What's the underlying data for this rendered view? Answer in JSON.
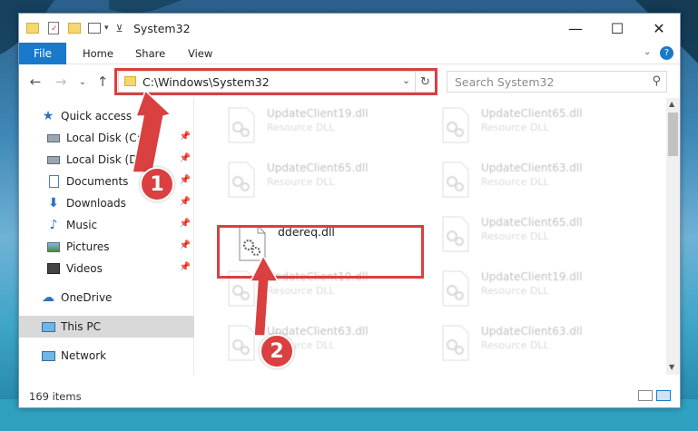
{
  "window": {
    "title": "System32"
  },
  "ribbon": {
    "tabs": [
      {
        "label": "File"
      },
      {
        "label": "Home"
      },
      {
        "label": "Share"
      },
      {
        "label": "View"
      }
    ]
  },
  "address": {
    "path": "C:\\Windows\\System32"
  },
  "search": {
    "placeholder": "Search System32"
  },
  "sidebar": {
    "items": [
      {
        "label": "Quick access",
        "icon": "star-icon"
      },
      {
        "label": "Local Disk (C:)",
        "icon": "drive-icon",
        "pinned": true
      },
      {
        "label": "Local Disk (D:)",
        "icon": "drive-icon",
        "pinned": true
      },
      {
        "label": "Documents",
        "icon": "documents-icon",
        "pinned": true
      },
      {
        "label": "Downloads",
        "icon": "downloads-icon",
        "pinned": true
      },
      {
        "label": "Music",
        "icon": "music-icon",
        "pinned": true
      },
      {
        "label": "Pictures",
        "icon": "pictures-icon",
        "pinned": true
      },
      {
        "label": "Videos",
        "icon": "videos-icon",
        "pinned": true
      },
      {
        "label": "OneDrive",
        "icon": "cloud-icon"
      },
      {
        "label": "This PC",
        "icon": "monitor-icon",
        "selected": true
      },
      {
        "label": "Network",
        "icon": "network-icon"
      }
    ]
  },
  "files": [
    {
      "name": "UpdateClient19.dll",
      "type": "Resource DLL",
      "faded": true
    },
    {
      "name": "UpdateClient65.dll",
      "type": "Resource DLL",
      "faded": true
    },
    {
      "name": "UpdateClient65.dll",
      "type": "Resource DLL",
      "faded": true
    },
    {
      "name": "UpdateClient63.dll",
      "type": "Resource DLL",
      "faded": true
    },
    {
      "name": "ddereq.dll",
      "type": "",
      "faded": false
    },
    {
      "name": "UpdateClient65.dll",
      "type": "Resource DLL",
      "faded": true
    },
    {
      "name": "UpdateClient19.dll",
      "type": "Resource DLL",
      "faded": true
    },
    {
      "name": "UpdateClient19.dll",
      "type": "Resource DLL",
      "faded": true
    },
    {
      "name": "UpdateClient63.dll",
      "type": "Resource DLL",
      "faded": true
    },
    {
      "name": "UpdateClient63.dll",
      "type": "Resource DLL",
      "faded": true
    }
  ],
  "status": {
    "item_count": "169 items"
  },
  "annotations": {
    "step1": "1",
    "step2": "2",
    "accent_color": "#d9403f"
  },
  "colors": {
    "file_tab": "#1979ca",
    "selection": "#d9d9d9"
  }
}
